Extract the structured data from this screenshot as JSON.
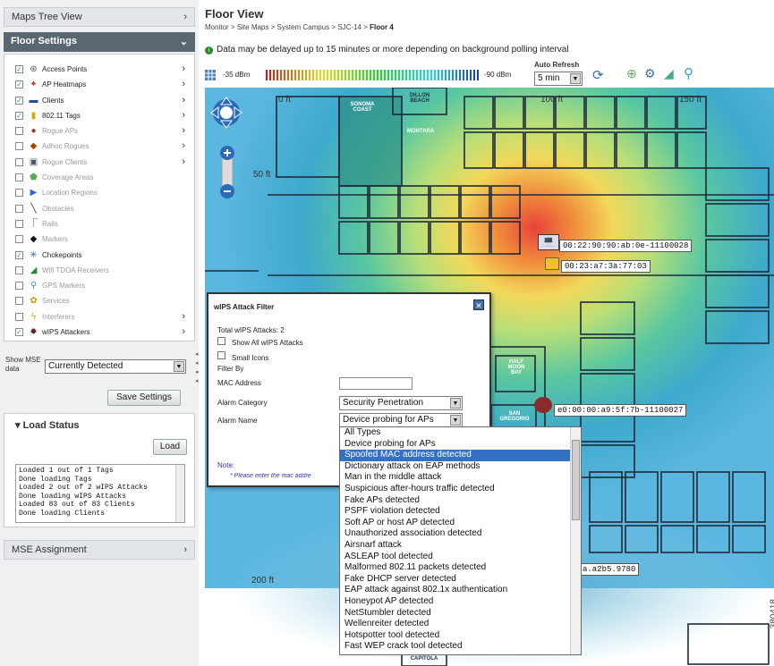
{
  "sidebar": {
    "maps_tree": "Maps Tree View",
    "floor_settings": "Floor Settings",
    "layers": [
      {
        "label": "Access Points",
        "checked": true,
        "icon": "access-point-icon",
        "arrow": true,
        "dim": false
      },
      {
        "label": "AP Heatmaps",
        "checked": true,
        "icon": "heatmap-icon",
        "arrow": true,
        "dim": false
      },
      {
        "label": "Clients",
        "checked": true,
        "icon": "client-icon",
        "arrow": true,
        "dim": false
      },
      {
        "label": "802.11 Tags",
        "checked": true,
        "icon": "tag-icon",
        "arrow": true,
        "dim": false
      },
      {
        "label": "Rogue APs",
        "checked": false,
        "icon": "rogue-ap-icon",
        "arrow": true,
        "dim": true
      },
      {
        "label": "Adhoc Rogues",
        "checked": false,
        "icon": "adhoc-rogue-icon",
        "arrow": true,
        "dim": true
      },
      {
        "label": "Rogue Clients",
        "checked": false,
        "icon": "rogue-client-icon",
        "arrow": true,
        "dim": true
      },
      {
        "label": "Coverage Areas",
        "checked": false,
        "icon": "coverage-icon",
        "arrow": false,
        "dim": true
      },
      {
        "label": "Location Regions",
        "checked": false,
        "icon": "region-icon",
        "arrow": false,
        "dim": true
      },
      {
        "label": "Obstacles",
        "checked": false,
        "icon": "obstacle-icon",
        "arrow": false,
        "dim": true
      },
      {
        "label": "Rails",
        "checked": false,
        "icon": "rail-icon",
        "arrow": false,
        "dim": true
      },
      {
        "label": "Markers",
        "checked": false,
        "icon": "marker-icon",
        "arrow": false,
        "dim": true
      },
      {
        "label": "Chokepoints",
        "checked": true,
        "icon": "chokepoint-icon",
        "arrow": false,
        "dim": false
      },
      {
        "label": "Wifi TDOA Receivers",
        "checked": false,
        "icon": "tdoa-icon",
        "arrow": false,
        "dim": true
      },
      {
        "label": "GPS Markers",
        "checked": false,
        "icon": "gps-icon",
        "arrow": false,
        "dim": true
      },
      {
        "label": "Services",
        "checked": false,
        "icon": "services-icon",
        "arrow": false,
        "dim": true
      },
      {
        "label": "Interferers",
        "checked": false,
        "icon": "interferer-icon",
        "arrow": true,
        "dim": true
      },
      {
        "label": "wIPS Attackers",
        "checked": true,
        "icon": "attacker-icon",
        "arrow": true,
        "dim": false
      }
    ],
    "show_mse_label": "Show MSE data",
    "mse_select": "Currently Detected",
    "save_button": "Save Settings",
    "load_status": "Load Status",
    "load_button": "Load",
    "load_log": [
      "Loaded 1 out of 1 Tags",
      "Done loading Tags",
      "Loaded 2 out of 2 wIPS Attacks",
      "Done loading wIPS Attacks",
      "Loaded 83 out of 83 Clients",
      "Done loading Clients"
    ],
    "mse_assignment": "MSE Assignment"
  },
  "header": {
    "title": "Floor View",
    "breadcrumb": [
      "Monitor",
      "Site Maps",
      "System Campus",
      "SJC-14",
      "Floor 4"
    ],
    "delay_note": "Data may be delayed up to 15 minutes or more depending on background polling interval",
    "rssi_min": "-35 dBm",
    "rssi_max": "-90 dBm",
    "auto_refresh_label": "Auto Refresh",
    "auto_refresh_value": "5 min"
  },
  "map": {
    "scale_x": [
      "0 ft",
      "100 ft",
      "150 ft"
    ],
    "scale_y": [
      "50 ft",
      "200 ft"
    ],
    "rooms": [
      "SONOMA COAST",
      "DILLON BEACH",
      "MONTARA",
      "HALF MOON BAY",
      "SAN GREGORIO",
      "CAPITOLA"
    ],
    "client_tag_1": "00:22:90:90:ab:0e-11100028",
    "client_tag_2": "00:23:a7:3a:77:03",
    "attacker_tag": "e0:00:00:a9:5f:7b-11100027",
    "mac_tag": "a.a2b5.9780"
  },
  "filter": {
    "title": "wIPS Attack Filter",
    "total": "Total wIPS Attacks: 2",
    "show_all": "Show All wIPS Attacks",
    "small_icons": "Small Icons",
    "filter_by": "Filter By",
    "mac_label": "MAC Address",
    "category_label": "Alarm Category",
    "category_value": "Security Penetration",
    "name_label": "Alarm Name",
    "name_value": "Device probing for APs",
    "note": "Note:",
    "note_text": "* Please enter the mac addre"
  },
  "alarm_options": [
    "All Types",
    "Device probing for APs",
    "Spoofed MAC address detected",
    "Dictionary attack on EAP methods",
    "Man in the middle attack",
    "Suspicious after-hours traffic detected",
    "Fake APs detected",
    "PSPF violation detected",
    "Soft AP or host AP detected",
    "Unauthorized association detected",
    "Airsnarf attack",
    "ASLEAP tool detected",
    "Malformed 802.11 packets detected",
    "Fake DHCP server detected",
    "EAP attack against 802.1x authentication",
    "Honeypot AP detected",
    "NetStumbler detected",
    "Wellenreiter detected",
    "Hotspotter tool detected",
    "Fast WEP crack tool detected"
  ],
  "selected_alarm_index": 2,
  "figure_id": "380418",
  "colors": {
    "accent": "#5b6770",
    "selection": "#3470c6"
  }
}
